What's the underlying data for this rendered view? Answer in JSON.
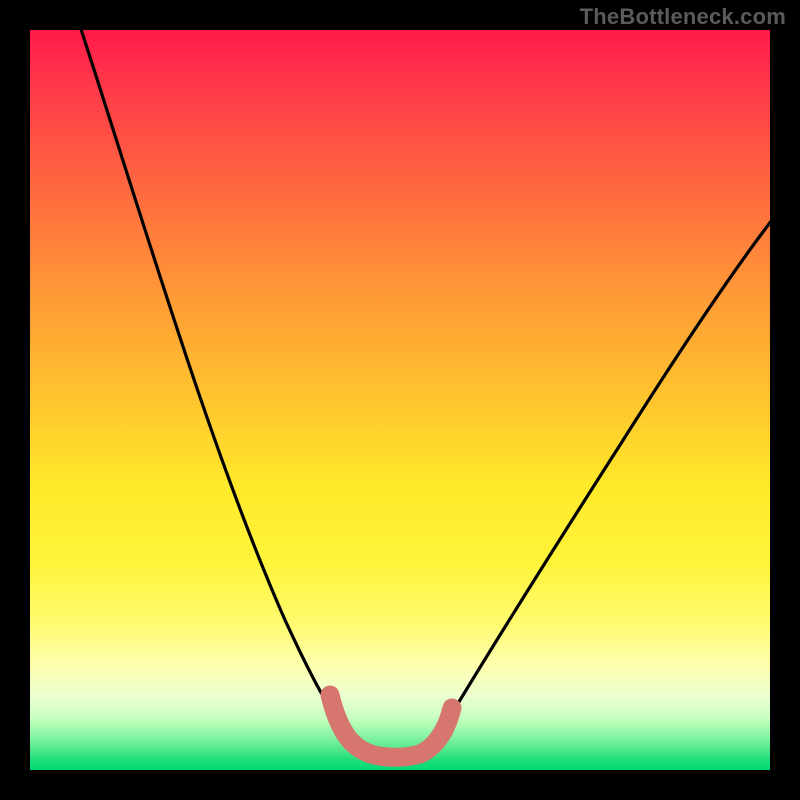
{
  "watermark": "TheBottleneck.com",
  "chart_data": {
    "type": "line",
    "title": "",
    "xlabel": "",
    "ylabel": "",
    "xlim": [
      0,
      100
    ],
    "ylim": [
      0,
      100
    ],
    "gradient_stops": [
      {
        "pct": 0,
        "color": "#ff1a4a"
      },
      {
        "pct": 8,
        "color": "#ff3a49"
      },
      {
        "pct": 22,
        "color": "#ff6a3f"
      },
      {
        "pct": 36,
        "color": "#ff9a36"
      },
      {
        "pct": 50,
        "color": "#ffc52e"
      },
      {
        "pct": 62,
        "color": "#ffea2a"
      },
      {
        "pct": 72,
        "color": "#fff43a"
      },
      {
        "pct": 80,
        "color": "#fffb6e"
      },
      {
        "pct": 86,
        "color": "#fdffb0"
      },
      {
        "pct": 90,
        "color": "#ecffd0"
      },
      {
        "pct": 93,
        "color": "#c8ffbf"
      },
      {
        "pct": 95,
        "color": "#93f7a8"
      },
      {
        "pct": 97,
        "color": "#5aeb8e"
      },
      {
        "pct": 98.5,
        "color": "#23df7d"
      },
      {
        "pct": 100,
        "color": "#00d873"
      }
    ],
    "series": [
      {
        "name": "bottleneck-curve",
        "color": "#000000",
        "x": [
          5,
          10,
          15,
          20,
          25,
          30,
          35,
          40,
          42,
          45,
          48,
          52,
          55,
          60,
          65,
          70,
          75,
          80,
          85,
          90,
          95,
          100
        ],
        "y": [
          100,
          85,
          71,
          58,
          45,
          33,
          22,
          12,
          8,
          4,
          2,
          2,
          4,
          9,
          15,
          22,
          29,
          36,
          43,
          50,
          56,
          62
        ]
      },
      {
        "name": "optimal-zone-marker",
        "color": "#d6766f",
        "x": [
          40,
          42,
          44,
          46,
          48,
          50,
          52,
          54,
          56
        ],
        "y": [
          11,
          7,
          4,
          2.5,
          2,
          2,
          2.5,
          4,
          8
        ]
      }
    ],
    "optimal_range_x": [
      42,
      55
    ],
    "min_y": 2
  }
}
